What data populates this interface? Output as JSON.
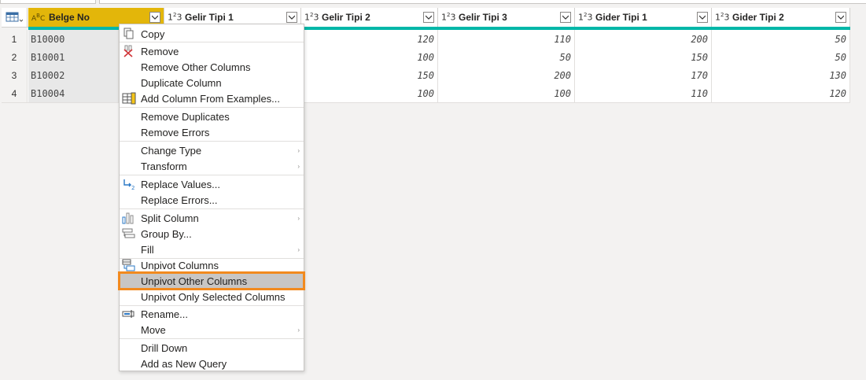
{
  "columns": [
    {
      "type": "ABC",
      "name": "Belge No"
    },
    {
      "type": "123",
      "name": "Gelir Tipi 1"
    },
    {
      "type": "123",
      "name": "Gelir Tipi 2"
    },
    {
      "type": "123",
      "name": "Gelir Tipi 3"
    },
    {
      "type": "123",
      "name": "Gider Tipi 1"
    },
    {
      "type": "123",
      "name": "Gider Tipi 2"
    }
  ],
  "rows": [
    {
      "idx": "1",
      "belge": "B10000",
      "vals": [
        "120",
        "110",
        "200",
        "50"
      ]
    },
    {
      "idx": "2",
      "belge": "B10001",
      "vals": [
        "100",
        "50",
        "150",
        "50"
      ]
    },
    {
      "idx": "3",
      "belge": "B10002",
      "vals": [
        "150",
        "200",
        "170",
        "130"
      ]
    },
    {
      "idx": "4",
      "belge": "B10004",
      "vals": [
        "100",
        "100",
        "110",
        "120"
      ]
    }
  ],
  "menu": [
    {
      "label": "Copy",
      "icon": "copy-icon"
    },
    {
      "label": "Remove",
      "icon": "remove-icon"
    },
    {
      "label": "Remove Other Columns"
    },
    {
      "label": "Duplicate Column"
    },
    {
      "label": "Add Column From Examples...",
      "icon": "add-column-examples-icon"
    },
    {
      "label": "Remove Duplicates"
    },
    {
      "label": "Remove Errors"
    },
    {
      "label": "Change Type",
      "submenu": true
    },
    {
      "label": "Transform",
      "submenu": true
    },
    {
      "label": "Replace Values...",
      "icon": "replace-values-icon"
    },
    {
      "label": "Replace Errors..."
    },
    {
      "label": "Split Column",
      "icon": "split-column-icon",
      "submenu": true
    },
    {
      "label": "Group By...",
      "icon": "group-by-icon"
    },
    {
      "label": "Fill",
      "submenu": true
    },
    {
      "label": "Unpivot Columns",
      "icon": "unpivot-icon"
    },
    {
      "label": "Unpivot Other Columns",
      "highlighted": true
    },
    {
      "label": "Unpivot Only Selected Columns"
    },
    {
      "label": "Rename...",
      "icon": "rename-icon"
    },
    {
      "label": "Move",
      "submenu": true
    },
    {
      "label": "Drill Down"
    },
    {
      "label": "Add as New Query"
    }
  ],
  "colors": {
    "accent": "#00b7a8",
    "selected_header": "#e3b60a",
    "highlight_border": "#f28a1e"
  }
}
